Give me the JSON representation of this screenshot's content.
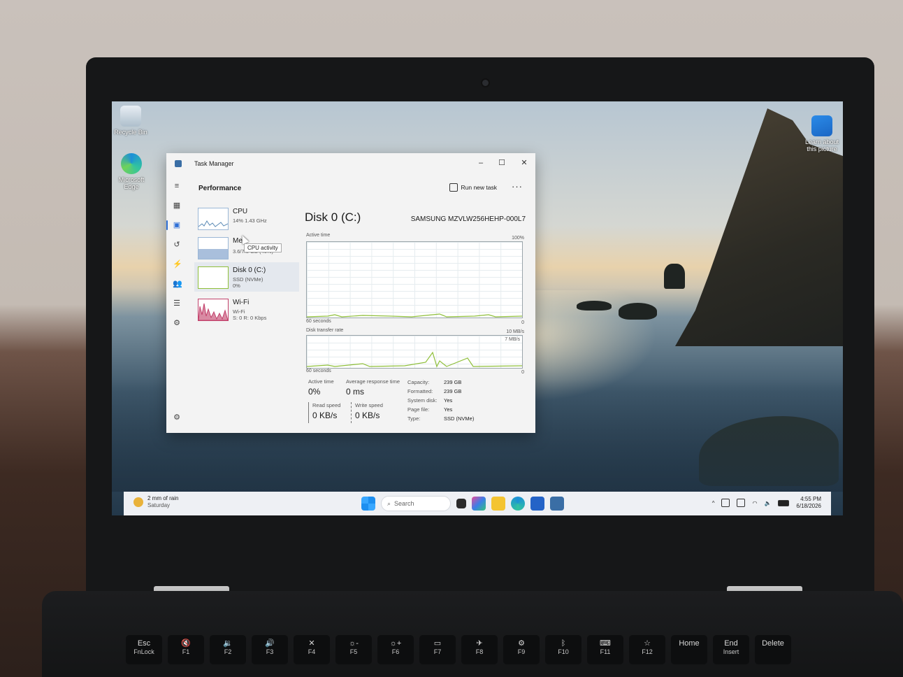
{
  "desktop": {
    "icons": [
      {
        "label": "Recycle Bin"
      },
      {
        "label": "Microsoft Edge"
      },
      {
        "label": "Learn about this picture"
      }
    ]
  },
  "task_manager": {
    "window_title": "Task Manager",
    "page_title": "Performance",
    "run_new_task": "Run new task",
    "more": "···",
    "resources": [
      {
        "name": "CPU",
        "detail1": "14% 1.43 GHz",
        "detail2": ""
      },
      {
        "name": "Me",
        "detail1": "3.6/7.8 GB (46%)",
        "detail2": ""
      },
      {
        "name": "Disk 0 (C:)",
        "detail1": "SSD (NVMe)",
        "detail2": "0%"
      },
      {
        "name": "Wi-Fi",
        "detail1": "Wi-Fi",
        "detail2": "S: 0 R: 0 Kbps"
      }
    ],
    "tooltip": "CPU activity",
    "detail": {
      "title": "Disk 0 (C:)",
      "model": "SAMSUNG MZVLW256HEHP-000L7",
      "chart1": {
        "label": "Active time",
        "max": "100%",
        "time": "60 seconds",
        "min": "0"
      },
      "chart2": {
        "label": "Disk transfer rate",
        "max": "10 MB/s",
        "inner_max": "7 MB/s",
        "time": "60 seconds",
        "min": "0"
      },
      "active_time_label": "Active time",
      "active_time_value": "0%",
      "avg_response_label": "Average response time",
      "avg_response_value": "0 ms",
      "read_speed_label": "Read speed",
      "read_speed_value": "0 KB/s",
      "write_speed_label": "Write speed",
      "write_speed_value": "0 KB/s",
      "properties": [
        {
          "key": "Capacity:",
          "value": "239 GB"
        },
        {
          "key": "Formatted:",
          "value": "239 GB"
        },
        {
          "key": "System disk:",
          "value": "Yes"
        },
        {
          "key": "Page file:",
          "value": "Yes"
        },
        {
          "key": "Type:",
          "value": "SSD (NVMe)"
        }
      ]
    }
  },
  "taskbar": {
    "weather_line1": "2 mm of rain",
    "weather_line2": "Saturday",
    "search_placeholder": "Search",
    "time": "4:55 PM",
    "date": "6/18/2026"
  },
  "keyboard": [
    {
      "top": "Esc",
      "bottom": "FnLock"
    },
    {
      "top": "🔇",
      "bottom": "F1"
    },
    {
      "top": "🔉",
      "bottom": "F2"
    },
    {
      "top": "🔊",
      "bottom": "F3"
    },
    {
      "top": "✕",
      "bottom": "F4"
    },
    {
      "top": "☼-",
      "bottom": "F5"
    },
    {
      "top": "☼+",
      "bottom": "F6"
    },
    {
      "top": "▭",
      "bottom": "F7"
    },
    {
      "top": "✈",
      "bottom": "F8"
    },
    {
      "top": "⚙",
      "bottom": "F9"
    },
    {
      "top": "ᛒ",
      "bottom": "F10"
    },
    {
      "top": "⌨",
      "bottom": "F11"
    },
    {
      "top": "☆",
      "bottom": "F12"
    },
    {
      "top": "Home",
      "bottom": ""
    },
    {
      "top": "End",
      "bottom": "Insert"
    },
    {
      "top": "Delete",
      "bottom": ""
    }
  ],
  "colors": {
    "accent": "#2e6fd6",
    "cpu_graph": "#5b8ab5",
    "wifi_graph": "#c2416b",
    "disk_graph": "#8fbf3a"
  }
}
